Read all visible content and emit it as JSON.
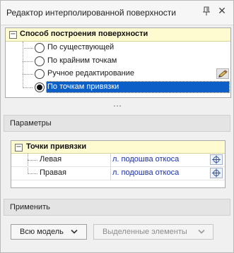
{
  "window": {
    "title": "Редактор интерполированной поверхности",
    "pin_icon": "pin-icon",
    "close_glyph": "✕"
  },
  "method_group": {
    "title": "Способ построения поверхности",
    "expander": "−",
    "options": [
      {
        "label": "По существующей",
        "selected": false
      },
      {
        "label": "По крайним точкам",
        "selected": false
      },
      {
        "label": "Ручное редактирование",
        "selected": false,
        "action_icon": "edit-pencil-icon"
      },
      {
        "label": "По точкам привязки",
        "selected": true
      }
    ]
  },
  "splitter": {
    "label": "..."
  },
  "parameters": {
    "section_label": "Параметры",
    "group_title": "Точки привязки",
    "expander": "−",
    "rows": [
      {
        "name": "Левая",
        "value": "л. подошва откоса",
        "pick_icon": "crosshair-icon"
      },
      {
        "name": "Правая",
        "value": "л. подошва откоса",
        "pick_icon": "crosshair-icon"
      }
    ]
  },
  "apply": {
    "section_label": "Применить",
    "all_model_button": "Всю модель",
    "selected_elements_button": "Выделенные элементы",
    "selected_elements_enabled": false
  },
  "colors": {
    "selection": "#0c5fc7",
    "group_header": "#fffbd0",
    "link_value": "#1b2fa6"
  }
}
